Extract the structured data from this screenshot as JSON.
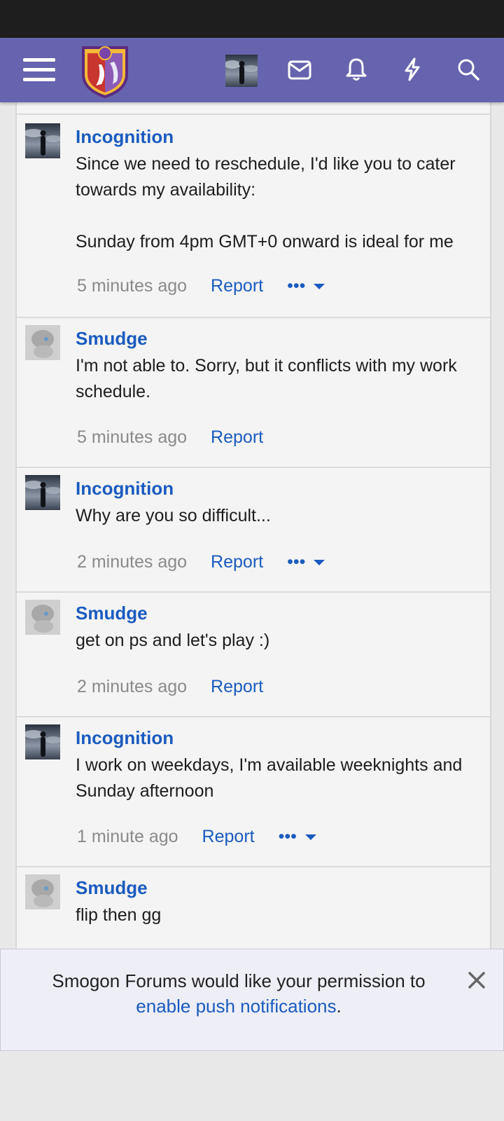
{
  "header": {
    "menu_icon": "hamburger-menu-icon",
    "logo_icon": "smogon-logo",
    "icons": [
      "inbox-icon",
      "bell-icon",
      "bolt-icon",
      "search-icon"
    ],
    "brand_color": "#6664ae"
  },
  "messages": [
    {
      "author": "Incognition",
      "body": "Since we need to reschedule, I'd like you to cater towards my availability:\n\nSunday from 4pm GMT+0 onward is ideal for me",
      "time": "5 minutes ago",
      "report": "Report",
      "more": "•••"
    },
    {
      "author": "Smudge",
      "body": "I'm not able to. Sorry, but it conflicts with my work schedule.",
      "time": "5 minutes ago",
      "report": "Report"
    },
    {
      "author": "Incognition",
      "body": "Why are you so difficult...",
      "time": "2 minutes ago",
      "report": "Report",
      "more": "•••"
    },
    {
      "author": "Smudge",
      "body": "get on ps and let's play :)",
      "time": "2 minutes ago",
      "report": "Report"
    },
    {
      "author": "Incognition",
      "body": "I work on weekdays, I'm available weeknights and Sunday afternoon",
      "time": "1 minute ago",
      "report": "Report",
      "more": "•••"
    },
    {
      "author": "Smudge",
      "body": "flip then gg"
    }
  ],
  "push_prompt": {
    "text": "Smogon Forums would like your permission to",
    "link": "enable push notifications",
    "suffix": "."
  }
}
